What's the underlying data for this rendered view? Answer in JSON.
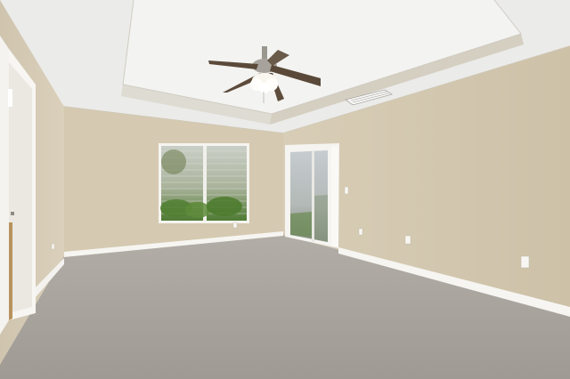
{
  "scene": {
    "description_visible_text": "",
    "colors": {
      "ceiling": "#eeeeec",
      "tray_ceiling": "#f4f4f2",
      "wall_left": "#d8cdb8",
      "wall_back": "#d4c8b0",
      "wall_right": "#d2c6ae",
      "carpet": "#a9a49d",
      "trim": "#f6f5f1",
      "window_green": "#5c7f3c",
      "fan_blade": "#5a4b3c"
    },
    "elements": [
      "ceiling-fan",
      "tray-ceiling",
      "air-vent",
      "window",
      "sliding-glass-door",
      "open-doorway",
      "carpet-floor",
      "baseboards",
      "wall-outlets",
      "light-switch"
    ]
  }
}
